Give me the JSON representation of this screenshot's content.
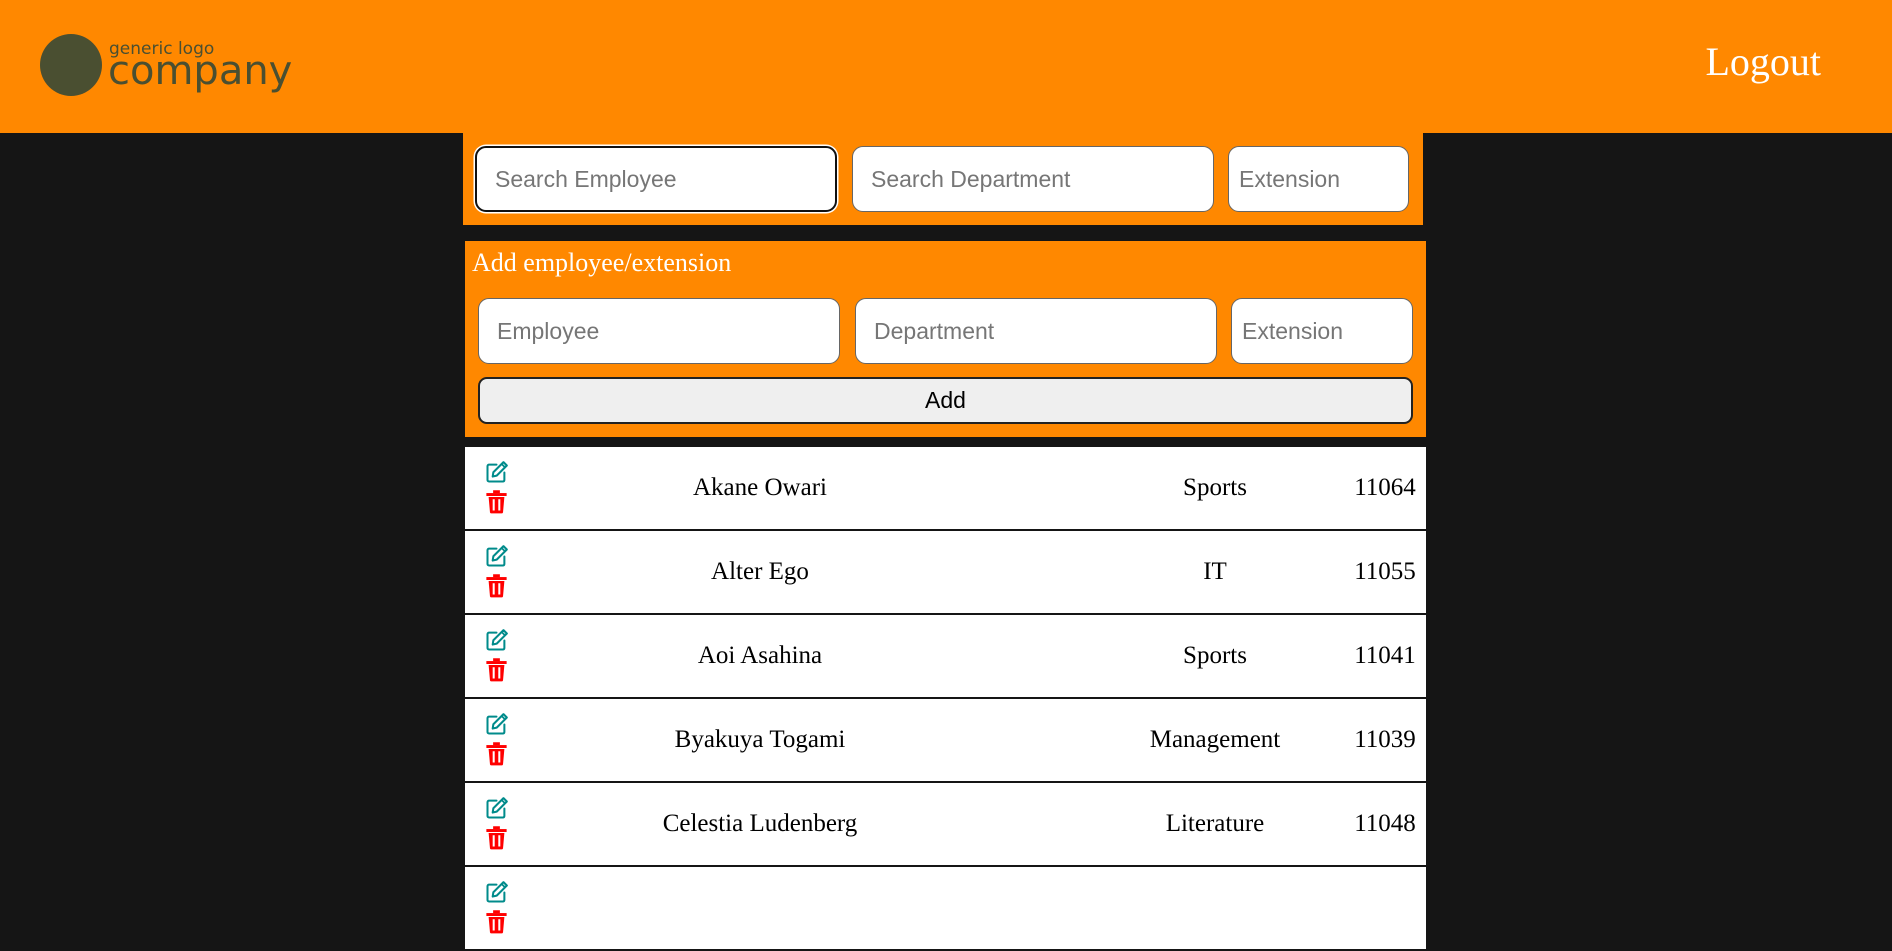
{
  "header": {
    "logo_small": "generic logo",
    "logo_big": "company",
    "logout_label": "Logout",
    "background_color": "#ff8800",
    "logo_color": "#4a4f31"
  },
  "search": {
    "employee_placeholder": "Search Employee",
    "department_placeholder": "Search Department",
    "extension_placeholder": "Extension"
  },
  "add_form": {
    "title": "Add employee/extension",
    "employee_placeholder": "Employee",
    "department_placeholder": "Department",
    "extension_placeholder": "Extension",
    "add_label": "Add"
  },
  "icons": {
    "edit": "edit-icon",
    "delete": "trash-icon",
    "edit_color": "#008b8b",
    "delete_color": "#ff0000"
  },
  "employees": [
    {
      "name": "Akane Owari",
      "department": "Sports",
      "extension": "11064"
    },
    {
      "name": "Alter Ego",
      "department": "IT",
      "extension": "11055"
    },
    {
      "name": "Aoi Asahina",
      "department": "Sports",
      "extension": "11041"
    },
    {
      "name": "Byakuya Togami",
      "department": "Management",
      "extension": "11039"
    },
    {
      "name": "Celestia Ludenberg",
      "department": "Literature",
      "extension": "11048"
    },
    {
      "name": "",
      "department": "",
      "extension": ""
    }
  ]
}
